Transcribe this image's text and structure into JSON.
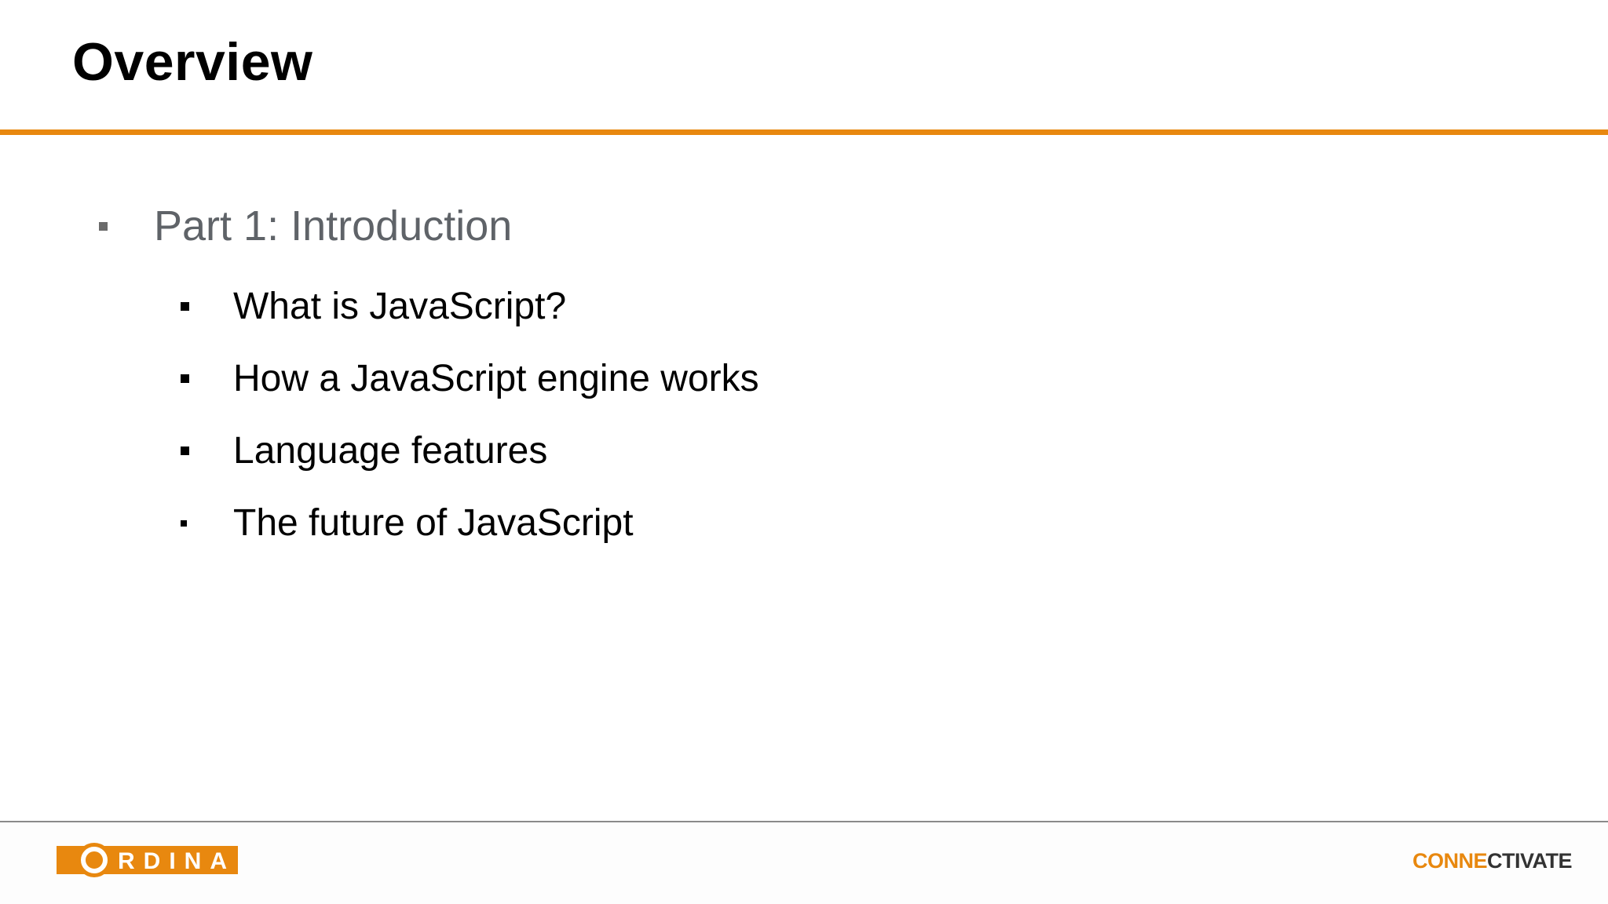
{
  "slide": {
    "title": "Overview",
    "bullets": {
      "level1": "Part 1: Introduction",
      "level2": [
        "What is JavaScript?",
        "How a JavaScript engine works",
        "Language features",
        "The future of JavaScript"
      ]
    }
  },
  "footer": {
    "left_logo": {
      "name": "ordina-logo",
      "text": "ORDINA"
    },
    "right_logo": {
      "name": "connectivate-logo",
      "text_orange": "CONNE",
      "text_dark": "CTIVATE"
    }
  },
  "colors": {
    "accent": "#e8880f",
    "title": "#000000",
    "level1_text": "#5f6368",
    "level2_text": "#000000",
    "footer_rule": "#8a8a8a"
  }
}
